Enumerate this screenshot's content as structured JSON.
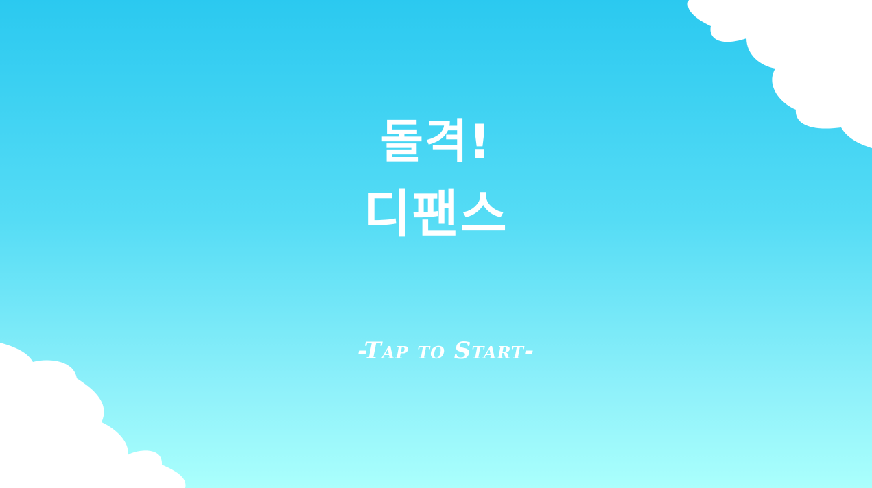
{
  "game": {
    "title_line1": "돌격!",
    "title_line2": "디팬스",
    "start_prompt": "-Tap to Start-"
  },
  "colors": {
    "sky_top": "#2bc9f0",
    "sky_bottom": "#aafffc",
    "cloud": "#ffffff",
    "text": "#ffffff"
  },
  "icons": [
    "cloud",
    "cloud"
  ]
}
